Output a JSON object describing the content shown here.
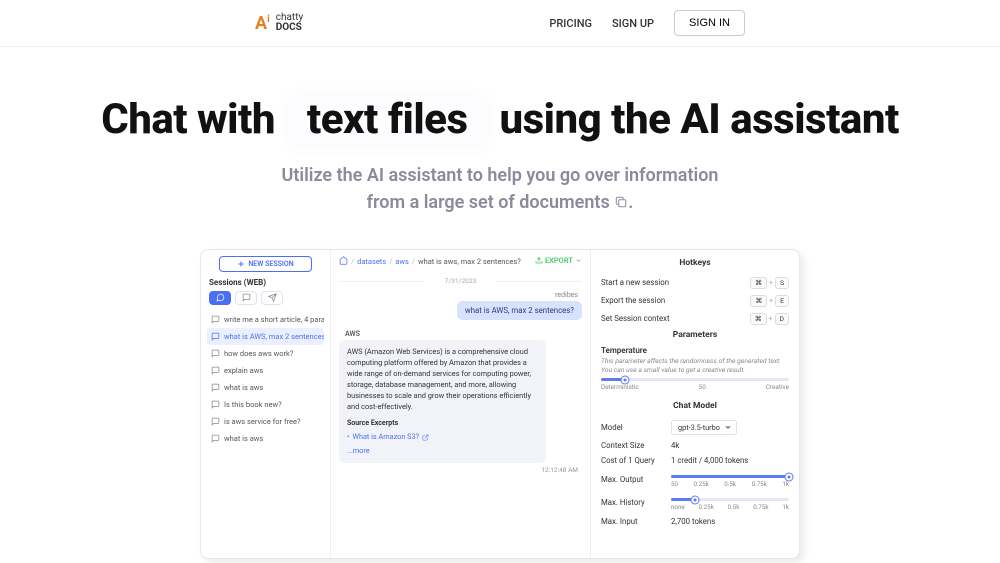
{
  "header": {
    "logo_top": "chatty",
    "logo_bottom": "DOCS",
    "nav": {
      "pricing": "PRICING",
      "signup": "SIGN UP",
      "signin": "SIGN IN"
    }
  },
  "hero": {
    "h1_a": "Chat with",
    "h1_highlight": "text files",
    "h1_b": "using the AI assistant",
    "sub_line1": "Utilize the AI assistant to help you go over information",
    "sub_line2": "from a large set of documents "
  },
  "left": {
    "new_session": "NEW SESSION",
    "sessions_label": "Sessions (WEB)",
    "items": [
      {
        "label": "write me a short article, 4 para..."
      },
      {
        "label": "what is AWS, max 2 sentences?"
      },
      {
        "label": "how does aws work?"
      },
      {
        "label": "explain aws"
      },
      {
        "label": "what is aws"
      },
      {
        "label": "Is this book new?"
      },
      {
        "label": "is aws service for free?"
      },
      {
        "label": "what is aws"
      }
    ]
  },
  "mid": {
    "crumbs": {
      "home": "⌂",
      "a": "datasets",
      "b": "aws",
      "c": "what is aws, max 2 sentences?"
    },
    "export": "EXPORT",
    "date": "7/31/2023",
    "user_name": "redibes",
    "user_msg": "what is AWS, max 2 sentences?",
    "ai_label": "AWS",
    "ai_text": "AWS (Amazon Web Services) is a comprehensive cloud computing platform offered by Amazon that provides a wide range of on-demand services for computing power, storage, database management, and more, allowing businesses to scale and grow their operations efficiently and cost-effectively.",
    "src_title": "Source Excerpts",
    "src_link": "What is Amazon S3?",
    "more": "...more",
    "time": "12:12:48 AM"
  },
  "right": {
    "hotkeys_title": "Hotkeys",
    "hk": [
      {
        "label": "Start a new session",
        "k1": "⌘",
        "k2": "S"
      },
      {
        "label": "Export the session",
        "k1": "⌘",
        "k2": "E"
      },
      {
        "label": "Set Session context",
        "k1": "⌘",
        "k2": "D"
      }
    ],
    "params_title": "Parameters",
    "temp_label": "Temperature",
    "temp_desc": "This parameter affects the randomness of the generated text. You can use a small value to get a creative result.",
    "temp_left": "Deterministic",
    "temp_mid": "50",
    "temp_right": "Creative",
    "chatmodel_title": "Chat Model",
    "model_label": "Model",
    "model_value": "gpt-3.5-turbo",
    "ctx_label": "Context Size",
    "ctx_value": "4k",
    "cost_label": "Cost of 1 Query",
    "cost_value": "1 credit  /  4,000 tokens",
    "maxout_label": "Max. Output",
    "maxout_ticks": {
      "a": "50",
      "b": "0.25k",
      "c": "0.5k",
      "d": "0.75k",
      "e": "1k"
    },
    "maxhist_label": "Max. History",
    "maxhist_ticks": {
      "a": "none",
      "b": "0.25k",
      "c": "0.5k",
      "d": "0.75k",
      "e": "1k"
    },
    "maxin_label": "Max. Input",
    "maxin_value": "2,700 tokens"
  }
}
